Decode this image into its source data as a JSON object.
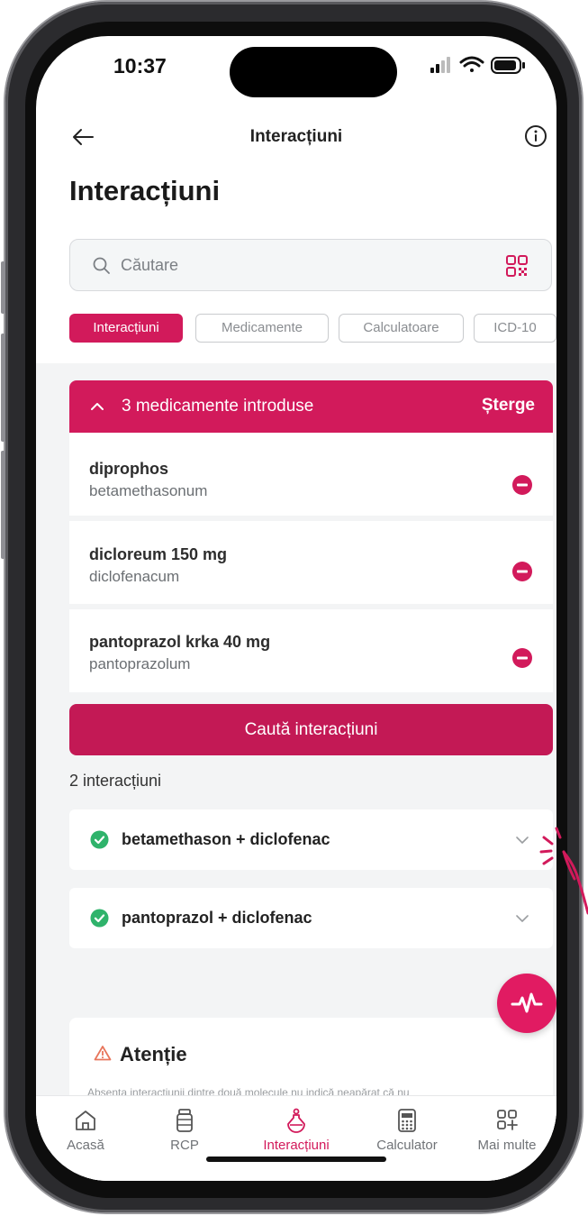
{
  "status_bar": {
    "time": "10:37"
  },
  "nav": {
    "title": "Interacțiuni"
  },
  "page": {
    "title": "Interacțiuni"
  },
  "search": {
    "placeholder": "Căutare"
  },
  "chips": [
    {
      "label": "Interacțiuni",
      "active": true
    },
    {
      "label": "Medicamente",
      "active": false
    },
    {
      "label": "Calculatoare",
      "active": false
    },
    {
      "label": "ICD-10",
      "active": false
    }
  ],
  "drug_list": {
    "header": "3 medicamente introduse",
    "clear_label": "Șterge",
    "items": [
      {
        "name": "diprophos",
        "substance": "betamethasonum"
      },
      {
        "name": "dicloreum 150 mg",
        "substance": "diclofenacum"
      },
      {
        "name": "pantoprazol krka 40 mg",
        "substance": "pantoprazolum"
      }
    ]
  },
  "search_button": {
    "label": "Caută interacțiuni"
  },
  "interactions": {
    "count_label": "2 interacțiuni",
    "items": [
      {
        "label": "betamethason + diclofenac"
      },
      {
        "label": "pantoprazol + diclofenac"
      }
    ]
  },
  "attention": {
    "title": "Atenție",
    "text": "Absența interacțiunii dintre două molecule nu indică neapărat că nu"
  },
  "tab_bar": {
    "items": [
      {
        "label": "Acasă",
        "icon": "home-icon"
      },
      {
        "label": "RCP",
        "icon": "pill-bottle-icon"
      },
      {
        "label": "Interacțiuni",
        "icon": "flask-icon",
        "active": true
      },
      {
        "label": "Calculator",
        "icon": "calculator-icon"
      },
      {
        "label": "Mai multe",
        "icon": "grid-plus-icon"
      }
    ]
  },
  "colors": {
    "accent": "#d21a5b",
    "check": "#2fb36b",
    "page_bg": "#f3f4f5"
  }
}
